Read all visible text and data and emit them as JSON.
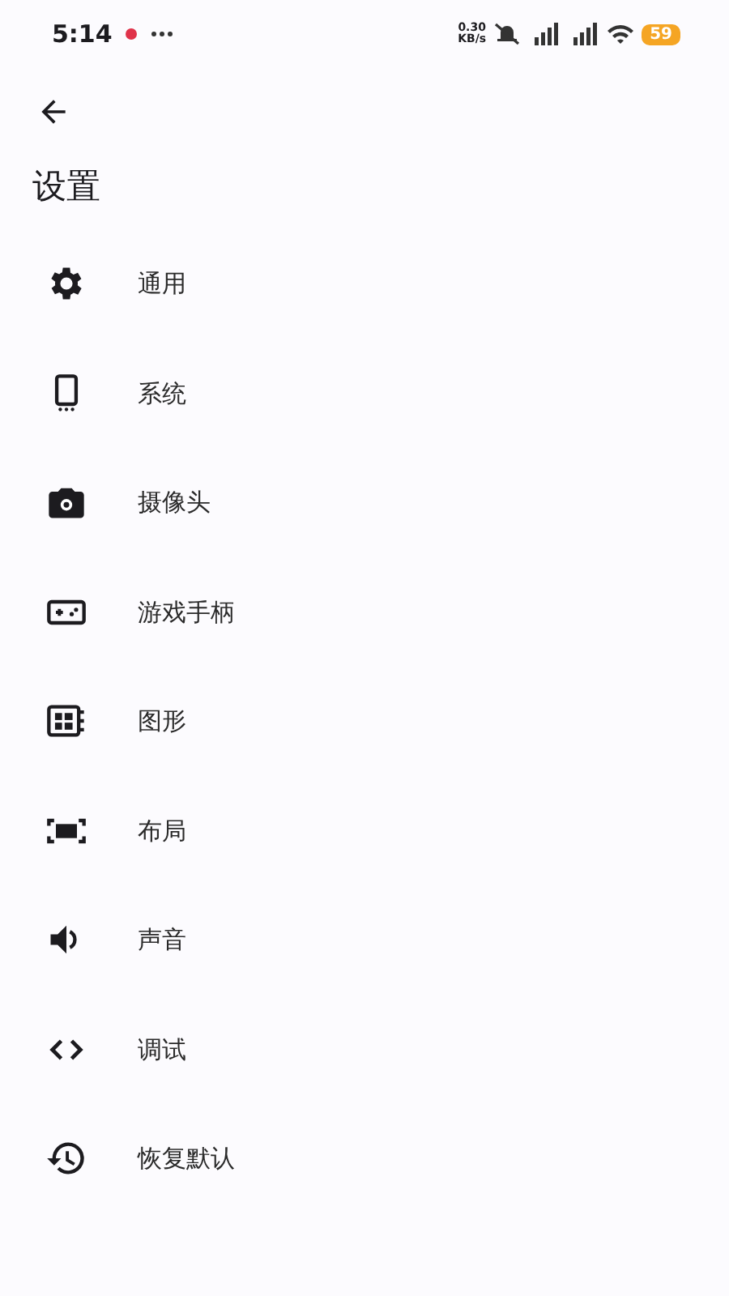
{
  "status_bar": {
    "time": "5:14",
    "speed_value": "0.30",
    "speed_unit": "KB/s",
    "battery": "59"
  },
  "title": "设置",
  "items": [
    {
      "kind": "gear",
      "label": "通用"
    },
    {
      "kind": "phone",
      "label": "系统"
    },
    {
      "kind": "camera",
      "label": "摄像头"
    },
    {
      "kind": "gamepad",
      "label": "游戏手柄"
    },
    {
      "kind": "graphics",
      "label": "图形"
    },
    {
      "kind": "layout",
      "label": "布局"
    },
    {
      "kind": "sound",
      "label": "声音"
    },
    {
      "kind": "code",
      "label": "调试"
    },
    {
      "kind": "restore",
      "label": "恢复默认"
    }
  ]
}
